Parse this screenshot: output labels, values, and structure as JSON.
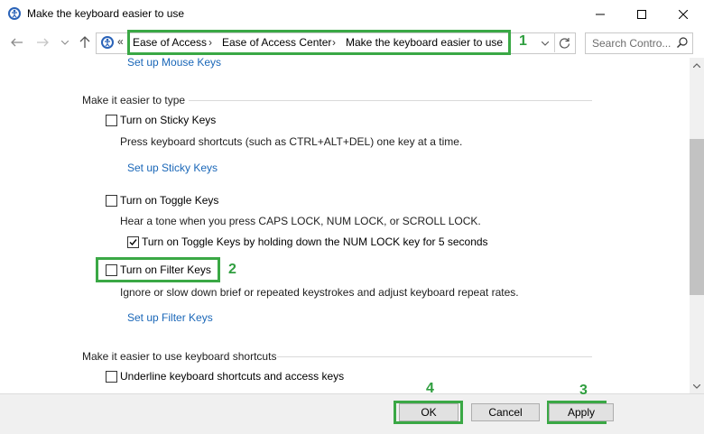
{
  "window": {
    "title": "Make the keyboard easier to use",
    "minimize": "—",
    "maximize": "☐",
    "close": "✕"
  },
  "address": {
    "overflow": "«",
    "breadcrumbs": [
      "Ease of Access",
      "Ease of Access Center",
      "Make the keyboard easier to use"
    ],
    "separator": "›",
    "search_placeholder": "Search Contro..."
  },
  "content": {
    "top_link": "Set up Mouse Keys",
    "section1": {
      "heading": "Make it easier to type",
      "sticky": {
        "label": "Turn on Sticky Keys",
        "checked": false,
        "desc": "Press keyboard shortcuts (such as CTRL+ALT+DEL) one key at a time.",
        "link": "Set up Sticky Keys"
      },
      "toggle": {
        "label": "Turn on Toggle Keys",
        "checked": false,
        "desc": "Hear a tone when you press CAPS LOCK, NUM LOCK, or SCROLL LOCK.",
        "sub_label": "Turn on Toggle Keys by holding down the NUM LOCK key for 5 seconds",
        "sub_checked": true
      },
      "filter": {
        "label": "Turn on Filter Keys",
        "checked": false,
        "desc": "Ignore or slow down brief or repeated keystrokes and adjust keyboard repeat rates.",
        "link": "Set up Filter Keys"
      }
    },
    "section2": {
      "heading": "Make it easier to use keyboard shortcuts",
      "underline": {
        "label": "Underline keyboard shortcuts and access keys",
        "checked": false
      }
    }
  },
  "footer": {
    "ok": "OK",
    "cancel": "Cancel",
    "apply": "Apply"
  },
  "annotations": [
    "1",
    "2",
    "3",
    "4"
  ],
  "colors": {
    "annotation": "#3aa845",
    "link": "#1a67b8"
  }
}
